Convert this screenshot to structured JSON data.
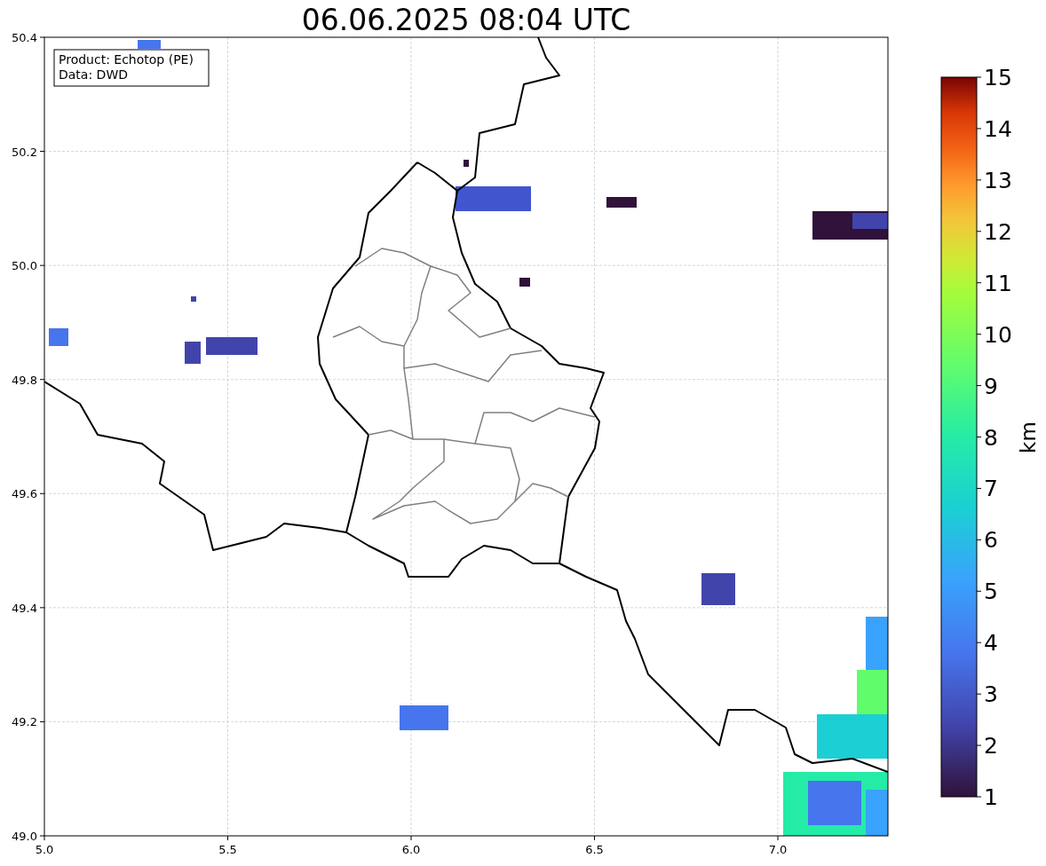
{
  "title": "06.06.2025 08:04 UTC",
  "info_box": [
    "Product: Echotop (PE)",
    "Data: DWD"
  ],
  "map": {
    "xticks": [
      "5.0",
      "5.5",
      "6.0",
      "6.5",
      "7.0"
    ],
    "yticks": [
      "50.4",
      "50.2",
      "50.0",
      "49.8",
      "49.6",
      "49.4",
      "49.2",
      "49.0"
    ]
  },
  "colorbar": {
    "label": "km",
    "ticks": [
      "15",
      "14",
      "13",
      "12",
      "11",
      "10",
      "9",
      "8",
      "7",
      "6",
      "5",
      "4",
      "3",
      "2",
      "1"
    ]
  }
}
